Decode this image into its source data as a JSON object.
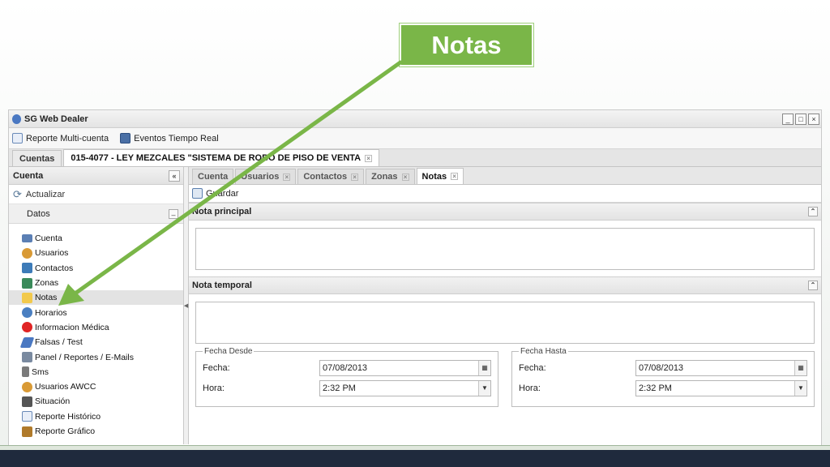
{
  "callout": {
    "label": "Notas"
  },
  "window": {
    "title": "SG Web Dealer",
    "controls": [
      "_",
      "□",
      "×"
    ]
  },
  "toolbar": {
    "items": [
      {
        "label": "Reporte Multi-cuenta",
        "icon": "report-icon"
      },
      {
        "label": "Eventos Tiempo Real",
        "icon": "monitor-icon"
      }
    ]
  },
  "outer_tabs": [
    {
      "label": "Cuentas",
      "active": false,
      "closable": false
    },
    {
      "label": "015-4077 - LEY MEZCALES \"SISTEMA DE ROBO DE PISO DE VENTA",
      "active": true,
      "closable": true
    }
  ],
  "sidebar": {
    "title": "Cuenta",
    "refresh_label": "Actualizar",
    "group_label": "Datos",
    "items": [
      {
        "label": "Cuenta",
        "icon": "id-card-icon",
        "color": "#5b7fb4"
      },
      {
        "label": "Usuarios",
        "icon": "users-icon",
        "color": "#d99a35"
      },
      {
        "label": "Contactos",
        "icon": "contacts-icon",
        "color": "#3d7bb8"
      },
      {
        "label": "Zonas",
        "icon": "zones-icon",
        "color": "#3a8a5a"
      },
      {
        "label": "Notas",
        "icon": "note-icon",
        "color": "#f2c94c"
      },
      {
        "label": "Horarios",
        "icon": "clock-icon",
        "color": "#4a7fc1"
      },
      {
        "label": "Informacion Médica",
        "icon": "medical-icon",
        "color": "#e02424"
      },
      {
        "label": "Falsas / Test",
        "icon": "pen-icon",
        "color": "#4a78c2"
      },
      {
        "label": "Panel / Reportes / E-Mails",
        "icon": "wrench-icon",
        "color": "#7a8aa0"
      },
      {
        "label": "Sms",
        "icon": "phone-icon",
        "color": "#7a7a7a"
      },
      {
        "label": "Usuarios AWCC",
        "icon": "users-icon",
        "color": "#d99a35"
      },
      {
        "label": "Situación",
        "icon": "building-icon",
        "color": "#555555"
      },
      {
        "label": "Reporte Histórico",
        "icon": "report-icon",
        "color": "#6a8ab8"
      },
      {
        "label": "Reporte Gráfico",
        "icon": "grid-chart-icon",
        "color": "#b07a2a"
      }
    ],
    "selected_index": 4
  },
  "inner_tabs": [
    {
      "label": "Cuenta",
      "active": false
    },
    {
      "label": "Usuarios",
      "active": false
    },
    {
      "label": "Contactos",
      "active": false
    },
    {
      "label": "Zonas",
      "active": false
    },
    {
      "label": "Notas",
      "active": true
    }
  ],
  "notes": {
    "save_label": "Guardar",
    "main_note": {
      "title": "Nota principal",
      "value": ""
    },
    "temp_note": {
      "title": "Nota temporal",
      "value": ""
    },
    "from": {
      "legend": "Fecha Desde",
      "date_label": "Fecha:",
      "date_value": "07/08/2013",
      "time_label": "Hora:",
      "time_value": "2:32 PM"
    },
    "to": {
      "legend": "Fecha Hasta",
      "date_label": "Fecha:",
      "date_value": "07/08/2013",
      "time_label": "Hora:",
      "time_value": "2:32 PM"
    }
  },
  "colors": {
    "callout": "#7ab648",
    "arrow": "#7ab648",
    "footer_band": "#1f2a3d"
  }
}
